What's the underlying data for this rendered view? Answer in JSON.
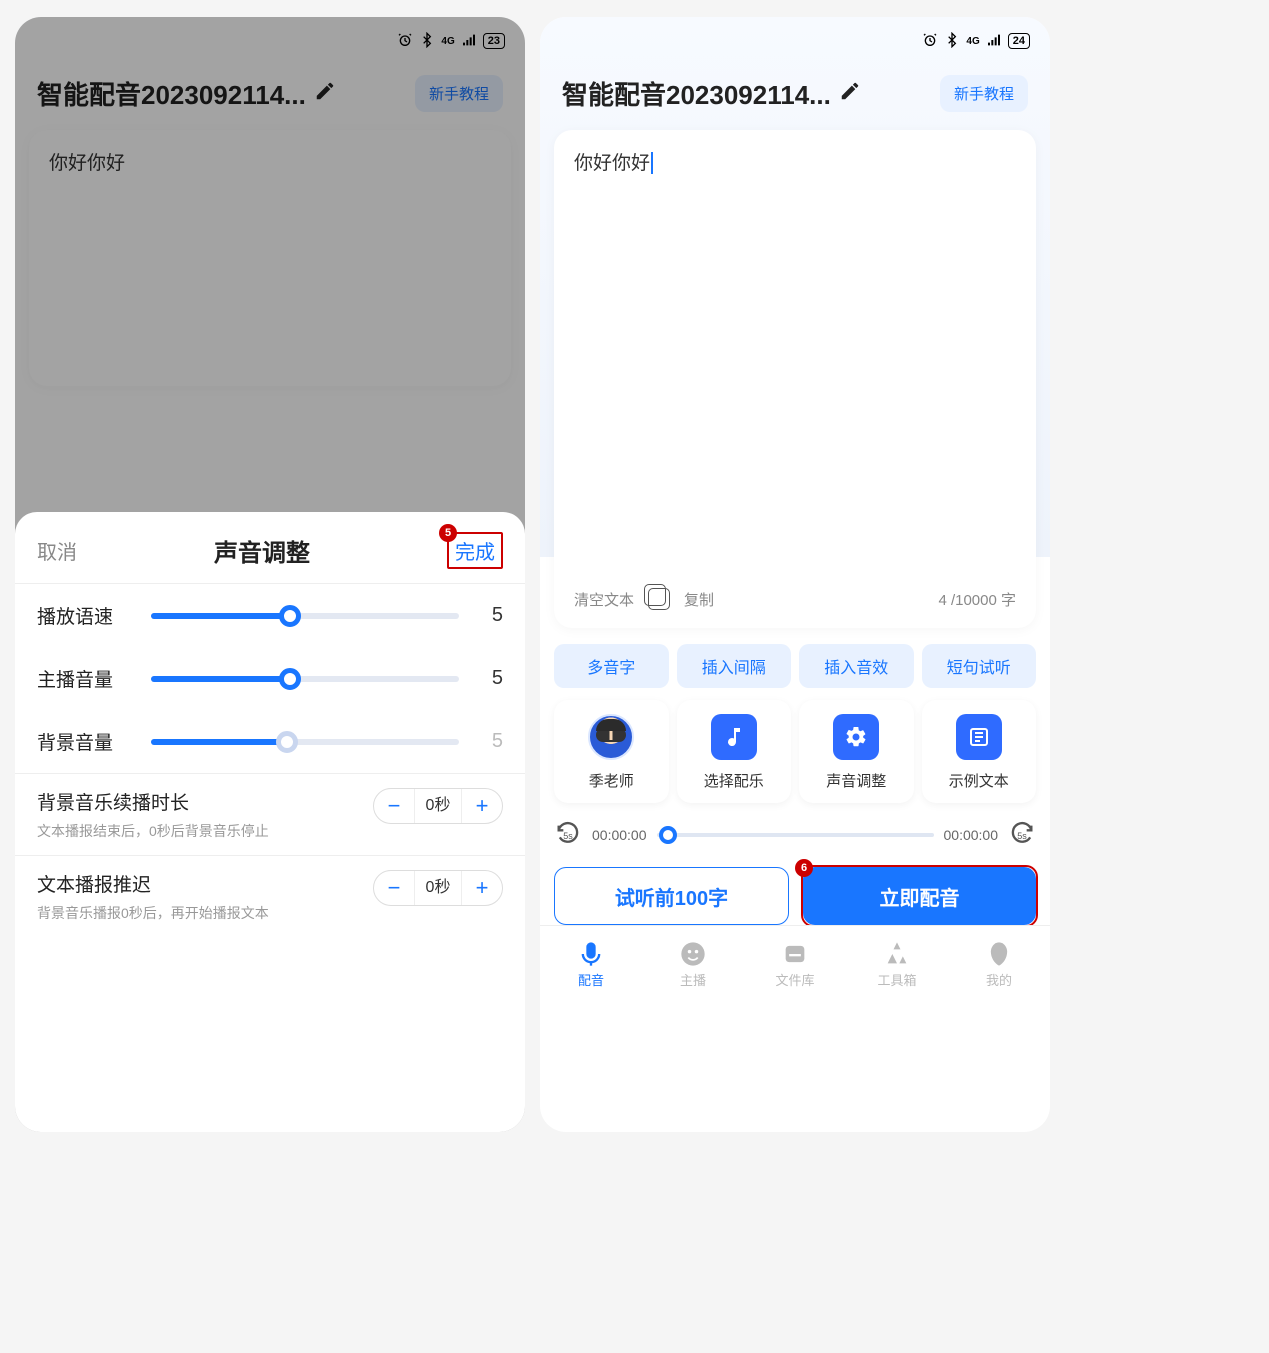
{
  "status": {
    "network": "4G",
    "battery_left": "23",
    "battery_right": "24"
  },
  "header": {
    "title": "智能配音2023092114...",
    "tutorial": "新手教程"
  },
  "editor": {
    "content": "你好你好",
    "clear": "清空文本",
    "copy": "复制",
    "counter": "4 /10000 字"
  },
  "chips": {
    "poly": "多音字",
    "gap": "插入间隔",
    "fx": "插入音效",
    "preview": "短句试听"
  },
  "tools": {
    "voice": "季老师",
    "music": "选择配乐",
    "sound": "声音调整",
    "sample": "示例文本"
  },
  "progress": {
    "back": "5s",
    "cur": "00:00:00",
    "dur": "00:00:00",
    "fwd": "5s"
  },
  "actions": {
    "trial": "试听前100字",
    "go": "立即配音",
    "go_badge": "6"
  },
  "nav": {
    "dub": "配音",
    "host": "主播",
    "files": "文件库",
    "tools": "工具箱",
    "mine": "我的"
  },
  "sheet": {
    "cancel": "取消",
    "title": "声音调整",
    "done": "完成",
    "done_badge": "5",
    "rows": {
      "speed": {
        "label": "播放语速",
        "value": "5",
        "pct": 45
      },
      "vol": {
        "label": "主播音量",
        "value": "5",
        "pct": 45
      },
      "bgvol": {
        "label": "背景音量",
        "value": "5",
        "pct": 44,
        "dim": true
      }
    },
    "extend": {
      "title": "背景音乐续播时长",
      "hint": "文本播报结束后，0秒后背景音乐停止",
      "value": "0秒"
    },
    "delay": {
      "title": "文本播报推迟",
      "hint": "背景音乐播报0秒后，再开始播报文本",
      "value": "0秒"
    }
  }
}
